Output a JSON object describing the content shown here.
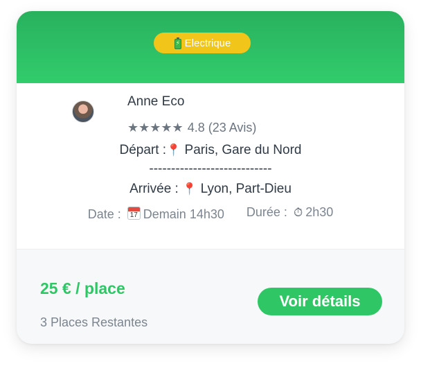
{
  "badge": {
    "icon": "battery-icon",
    "label": "Electrique"
  },
  "driver": {
    "name": "Anne Eco",
    "rating_stars": "★★★★★",
    "rating_text": "4.8 (23 Avis)"
  },
  "trip": {
    "departure_label": "Départ :",
    "departure_value": "Paris, Gare du Nord",
    "separator": "----------------------------",
    "arrival_label": "Arrivée :",
    "arrival_value": "Lyon, Part-Dieu",
    "date_label": "Date :",
    "date_icon_day": "17",
    "date_value": "Demain 14h30",
    "duration_label": "Durée :",
    "duration_value": "2h30",
    "pin_glyph": "📍",
    "timer_glyph": "⏱"
  },
  "footer": {
    "price": "25 € / place",
    "seats": "3 Places Restantes",
    "details_button": "Voir détails"
  },
  "colors": {
    "accent_green": "#2fc766",
    "badge_yellow": "#f2c51a"
  }
}
